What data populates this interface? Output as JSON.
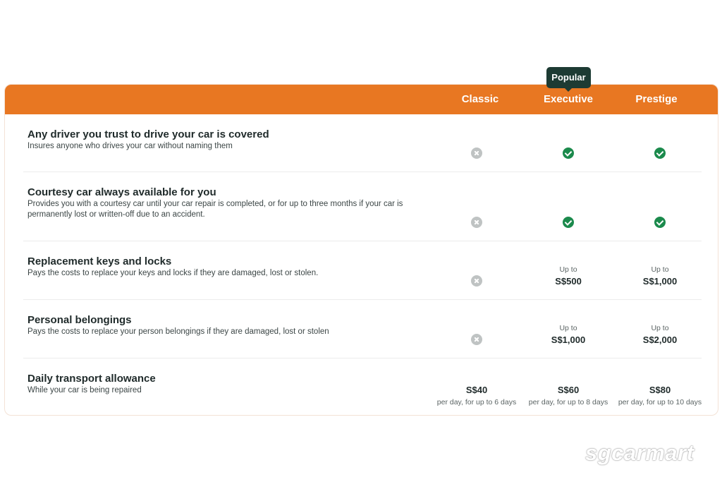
{
  "plans": [
    "Classic",
    "Executive",
    "Prestige"
  ],
  "badge": "Popular",
  "rows": [
    {
      "title": "Any driver you trust to drive your car is covered",
      "desc": "Insures anyone who drives your car without naming them",
      "cells": [
        {
          "type": "cross"
        },
        {
          "type": "check"
        },
        {
          "type": "check"
        }
      ]
    },
    {
      "title": "Courtesy car always available for you",
      "desc": "Provides you with a courtesy car until your car repair is completed, or for up to three months if your car is permanently lost or written-off due to an accident.",
      "cells": [
        {
          "type": "cross"
        },
        {
          "type": "check"
        },
        {
          "type": "check"
        }
      ]
    },
    {
      "title": "Replacement keys and locks",
      "desc": "Pays the costs to replace your keys and locks if they are damaged, lost or stolen.",
      "cells": [
        {
          "type": "cross"
        },
        {
          "type": "amount",
          "prefix": "Up to",
          "value": "S$500"
        },
        {
          "type": "amount",
          "prefix": "Up to",
          "value": "S$1,000"
        }
      ]
    },
    {
      "title": "Personal belongings",
      "desc": "Pays the costs to replace your person belongings if they are damaged, lost or stolen",
      "cells": [
        {
          "type": "cross"
        },
        {
          "type": "amount",
          "prefix": "Up to",
          "value": "S$1,000"
        },
        {
          "type": "amount",
          "prefix": "Up to",
          "value": "S$2,000"
        }
      ]
    },
    {
      "title": "Daily transport allowance",
      "desc": "While your car is being repaired",
      "cells": [
        {
          "type": "allowance",
          "value": "S$40",
          "note": "per day, for up to 6 days"
        },
        {
          "type": "allowance",
          "value": "S$60",
          "note": "per day, for up to 8 days"
        },
        {
          "type": "allowance",
          "value": "S$80",
          "note": "per day, for up to 10 days"
        }
      ]
    }
  ],
  "watermark": "sgcarmart",
  "colors": {
    "header": "#e87722",
    "badge": "#1d3b33",
    "check": "#1b8a4c",
    "cross": "#bfc3c3"
  }
}
